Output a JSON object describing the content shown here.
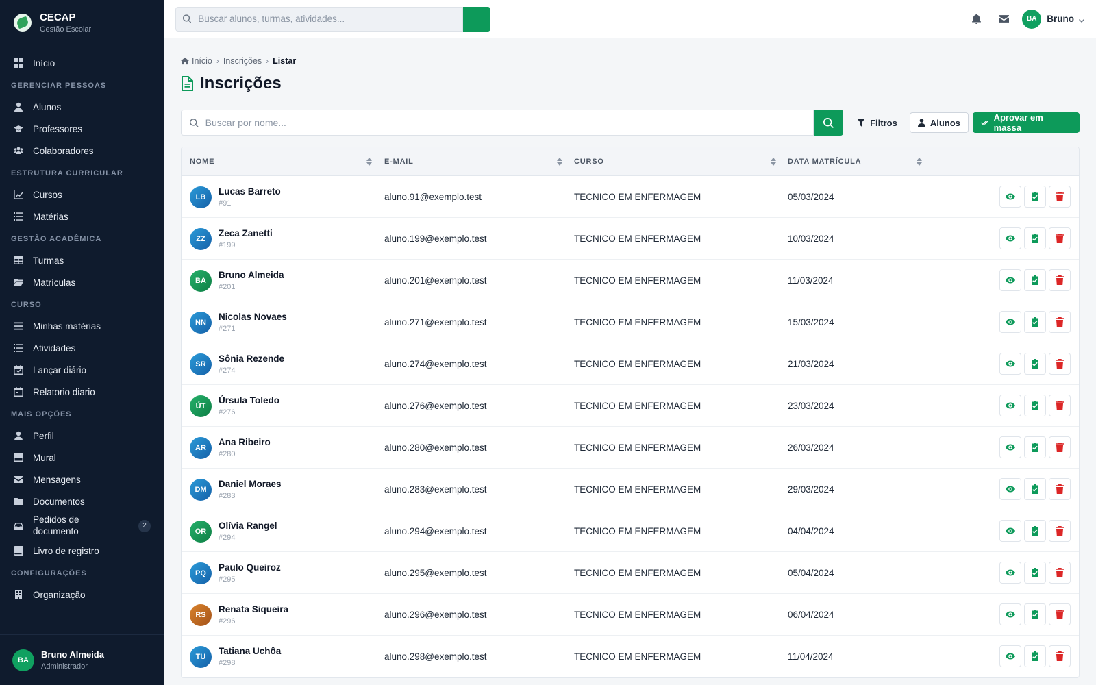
{
  "brand": {
    "name": "CECAP",
    "subtitle": "Gestão Escolar"
  },
  "sidebar": {
    "home": "Início",
    "sections": [
      {
        "title": "GERENCIAR PESSOAS",
        "items": [
          "Alunos",
          "Professores",
          "Colaboradores"
        ]
      },
      {
        "title": "ESTRUTURA CURRICULAR",
        "items": [
          "Cursos",
          "Matérias"
        ]
      },
      {
        "title": "GESTÃO ACADÊMICA",
        "items": [
          "Turmas",
          "Matrículas"
        ]
      },
      {
        "title": "CURSO",
        "items": [
          "Minhas matérias",
          "Atividades",
          "Lançar diário",
          "Relatorio diario"
        ]
      },
      {
        "title": "MAIS OPÇÕES",
        "items": [
          "Perfil",
          "Mural",
          "Mensagens",
          "Documentos",
          "Pedidos de documento",
          "Livro de registro"
        ]
      },
      {
        "title": "CONFIGURAÇÕES",
        "items": [
          "Organização"
        ]
      }
    ],
    "pedidos_badge": "2",
    "user": {
      "initials": "BA",
      "name": "Bruno Almeida",
      "role": "Administrador"
    }
  },
  "topbar": {
    "search_placeholder": "Buscar alunos, turmas, atividades...",
    "user_initials": "BA",
    "user_name": "Bruno",
    "accent": "#0d9a5a"
  },
  "breadcrumb": {
    "home": "Início",
    "parent": "Inscrições",
    "current": "Listar"
  },
  "page": {
    "title": "Inscrições"
  },
  "toolbar": {
    "search_placeholder": "Buscar por nome...",
    "filters": "Filtros",
    "students": "Alunos",
    "approve_all": "Aprovar em massa"
  },
  "table": {
    "headers": {
      "name": "NOME",
      "email": "E-MAIL",
      "course": "CURSO",
      "date": "DATA MATRÍCULA"
    },
    "rows": [
      {
        "initials": "LB",
        "name": "Lucas Barreto",
        "id": "#91",
        "email": "aluno.91@exemplo.test",
        "course": "TECNICO EM ENFERMAGEM",
        "date": "05/03/2024",
        "color": "blue"
      },
      {
        "initials": "ZZ",
        "name": "Zeca Zanetti",
        "id": "#199",
        "email": "aluno.199@exemplo.test",
        "course": "TECNICO EM ENFERMAGEM",
        "date": "10/03/2024",
        "color": "blue"
      },
      {
        "initials": "BA",
        "name": "Bruno Almeida",
        "id": "#201",
        "email": "aluno.201@exemplo.test",
        "course": "TECNICO EM ENFERMAGEM",
        "date": "11/03/2024",
        "color": "green"
      },
      {
        "initials": "NN",
        "name": "Nicolas Novaes",
        "id": "#271",
        "email": "aluno.271@exemplo.test",
        "course": "TECNICO EM ENFERMAGEM",
        "date": "15/03/2024",
        "color": "blue"
      },
      {
        "initials": "SR",
        "name": "Sônia Rezende",
        "id": "#274",
        "email": "aluno.274@exemplo.test",
        "course": "TECNICO EM ENFERMAGEM",
        "date": "21/03/2024",
        "color": "blue"
      },
      {
        "initials": "ÚT",
        "name": "Úrsula Toledo",
        "id": "#276",
        "email": "aluno.276@exemplo.test",
        "course": "TECNICO EM ENFERMAGEM",
        "date": "23/03/2024",
        "color": "green"
      },
      {
        "initials": "AR",
        "name": "Ana Ribeiro",
        "id": "#280",
        "email": "aluno.280@exemplo.test",
        "course": "TECNICO EM ENFERMAGEM",
        "date": "26/03/2024",
        "color": "blue"
      },
      {
        "initials": "DM",
        "name": "Daniel Moraes",
        "id": "#283",
        "email": "aluno.283@exemplo.test",
        "course": "TECNICO EM ENFERMAGEM",
        "date": "29/03/2024",
        "color": "blue"
      },
      {
        "initials": "OR",
        "name": "Olívia Rangel",
        "id": "#294",
        "email": "aluno.294@exemplo.test",
        "course": "TECNICO EM ENFERMAGEM",
        "date": "04/04/2024",
        "color": "green"
      },
      {
        "initials": "PQ",
        "name": "Paulo Queiroz",
        "id": "#295",
        "email": "aluno.295@exemplo.test",
        "course": "TECNICO EM ENFERMAGEM",
        "date": "05/04/2024",
        "color": "blue"
      },
      {
        "initials": "RS",
        "name": "Renata Siqueira",
        "id": "#296",
        "email": "aluno.296@exemplo.test",
        "course": "TECNICO EM ENFERMAGEM",
        "date": "06/04/2024",
        "color": "orange"
      },
      {
        "initials": "TU",
        "name": "Tatiana Uchôa",
        "id": "#298",
        "email": "aluno.298@exemplo.test",
        "course": "TECNICO EM ENFERMAGEM",
        "date": "11/04/2024",
        "color": "blue"
      }
    ]
  }
}
